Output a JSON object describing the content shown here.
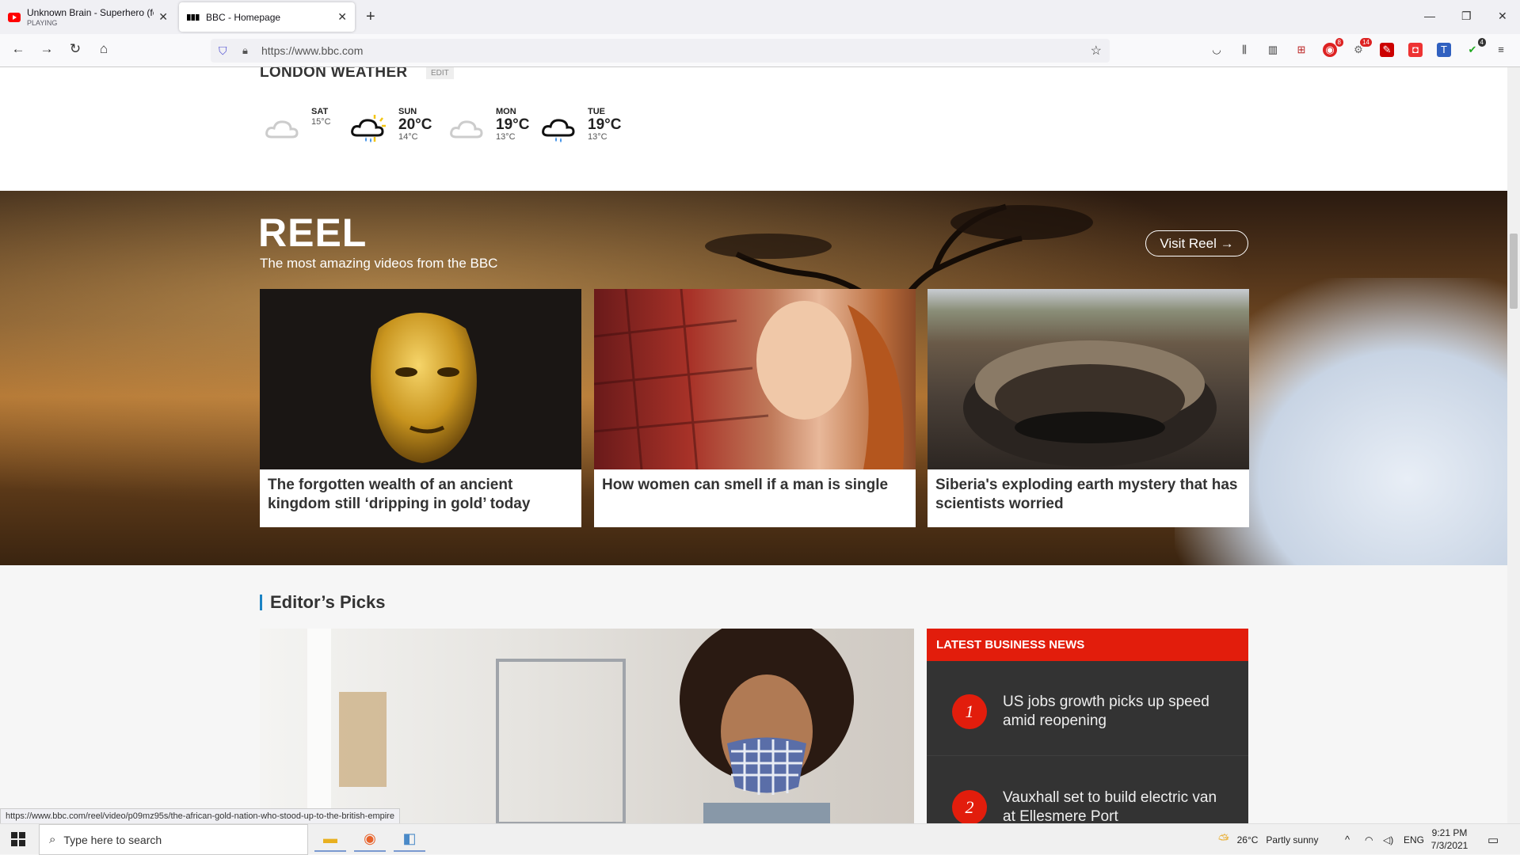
{
  "browser": {
    "tabs": [
      {
        "title": "Unknown Brain - Superhero (fe",
        "subtitle": "PLAYING"
      },
      {
        "title": "BBC - Homepage"
      }
    ],
    "url": "https://www.bbc.com",
    "ext_badges": {
      "ext1": "8",
      "ext2": "14",
      "ext3": "4"
    }
  },
  "weather": {
    "title": "LONDON WEATHER",
    "edit": "EDIT",
    "days": [
      {
        "name": "SAT",
        "hi": "15°C",
        "lo": "",
        "icon": "cloud-icon"
      },
      {
        "name": "SUN",
        "hi": "20°C",
        "lo": "14°C",
        "icon": "sun-rain-cloud-icon"
      },
      {
        "name": "MON",
        "hi": "19°C",
        "lo": "13°C",
        "icon": "cloud-icon"
      },
      {
        "name": "TUE",
        "hi": "19°C",
        "lo": "13°C",
        "icon": "rain-cloud-icon"
      }
    ]
  },
  "reel": {
    "title": "REEL",
    "tagline": "The most amazing videos from the BBC",
    "visit_label": "Visit Reel",
    "cards": [
      {
        "caption": "The forgotten wealth of an ancient kingdom still ‘dripping in gold’ today"
      },
      {
        "caption": "How women can smell if a man is single"
      },
      {
        "caption": "Siberia's exploding earth mystery that has scientists worried"
      }
    ]
  },
  "editors": {
    "title": "Editor’s Picks"
  },
  "business": {
    "header": "LATEST BUSINESS NEWS",
    "items": [
      {
        "num": "1",
        "text": "US jobs growth picks up speed amid reopening"
      },
      {
        "num": "2",
        "text": "Vauxhall set to build electric van at Ellesmere Port"
      }
    ]
  },
  "status_link": "https://www.bbc.com/reel/video/p09mz95s/the-african-gold-nation-who-stood-up-to-the-british-empire",
  "taskbar": {
    "search_placeholder": "Type here to search",
    "weather_temp": "26°C",
    "weather_desc": "Partly sunny",
    "lang": "ENG",
    "time": "9:21 PM",
    "date": "7/3/2021"
  },
  "colors": {
    "bbc_red": "#e21d0c",
    "editors_accent": "#1b83c4"
  }
}
